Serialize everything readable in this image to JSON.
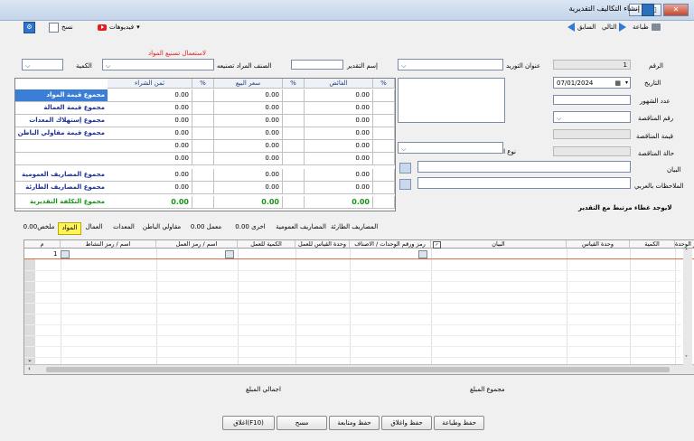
{
  "window": {
    "title": "إنشاء التكاليف التقديرية"
  },
  "toolbar": {
    "print": "طباعة",
    "next": "التالي",
    "previous": "السابق",
    "videos": "فيديوهات",
    "copy": "نسخ"
  },
  "form": {
    "number_label": "الرقم",
    "number_value": "1",
    "date_label": "التاريخ",
    "date_value": "07/01/2024",
    "months_label": "عدد الشهور",
    "tender_no_label": "رقم المناقصة",
    "tender_value_label": "قيمة المناقصة",
    "tender_status_label": "حالة المناقصة",
    "statement_label": "البيان",
    "notes_ar_label": "الملاحظات بالعربي",
    "supply_address_label": "عنوان التوريد",
    "activity_type_label": "نوع النشاط",
    "estimate_name_label": "إسم التقدير",
    "item_to_make_label": "الصنف المراد تصنيعه",
    "quantity_label": "الكمية",
    "materials_note": "لاستعمال تسنيع المواد",
    "no_cover_note": "لايوجد غطاء مرتبط مع التقدير"
  },
  "summary": {
    "headers": {
      "pct1": "%",
      "surplus": "الفائض",
      "pct2": "%",
      "sale_price": "سعر البيع",
      "pct3": "%",
      "purchase_price": "ثمن الشراء"
    },
    "rows": [
      {
        "label": "مجموع قيمة المواد",
        "v1": "0.00",
        "v2": "0.00",
        "v3": "0.00"
      },
      {
        "label": "مجموع قيمة العمالة",
        "v1": "0.00",
        "v2": "0.00",
        "v3": "0.00"
      },
      {
        "label": "مجموع إستهلاك المعدات",
        "v1": "0.00",
        "v2": "0.00",
        "v3": "0.00"
      },
      {
        "label": "مجموع قيمة مقاولي الباطن",
        "v1": "0.00",
        "v2": "0.00",
        "v3": "0.00"
      },
      {
        "label": "",
        "v1": "0.00",
        "v2": "0.00",
        "v3": "0.00"
      },
      {
        "label": "",
        "v1": "0.00",
        "v2": "0.00",
        "v3": "0.00"
      },
      {
        "label": "مجموع المصاريف العمومية",
        "v1": "0.00",
        "v2": "0.00",
        "v3": "0.00"
      },
      {
        "label": "مجموع المصاريف الطارئة",
        "v1": "0.00",
        "v2": "0.00",
        "v3": "0.00"
      },
      {
        "label": "مجموع التكلفة التقديرية",
        "v1": "0.00",
        "v2": "0.00",
        "v3": "0.00"
      }
    ]
  },
  "tabs": [
    {
      "label": "المصاريف الطارئة"
    },
    {
      "label": "المصاريف العمومية"
    },
    {
      "label": "اخرى 0.00"
    },
    {
      "label": "معمل 0.00"
    },
    {
      "label": "مقاولي الباطن"
    },
    {
      "label": "المعدات"
    },
    {
      "label": "العمال"
    },
    {
      "label": "المواد"
    },
    {
      "label": "ملخص0.00"
    }
  ],
  "table": {
    "columns": [
      "سعر الوحدة",
      "الكمية",
      "وحدة القياس",
      "البيان",
      "رمز ورقم الوحدات / الاصناف",
      "وحدة القياس للعمل",
      "الكمية للعمل",
      "اسم / رمز العمل",
      "اسم / رمز النشاط",
      "م"
    ],
    "first_row_number": "1"
  },
  "footer": {
    "total_amount_label": "مجموع المبلغ",
    "grand_total_label": "اجمالي المبلغ"
  },
  "buttons": {
    "save_print": "حفظ وطباعة",
    "save_close": "حفظ واغلاق",
    "save_next": "حفظ ومتابعة",
    "clear": "مسح",
    "close": "اغلاق(F10)"
  }
}
